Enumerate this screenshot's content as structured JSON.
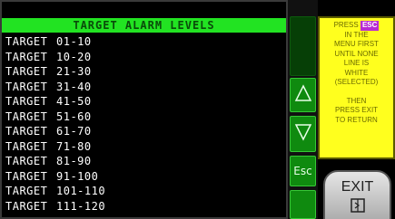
{
  "header": {
    "title": "TARGET ALARM LEVELS"
  },
  "list": {
    "items": [
      {
        "label": "TARGET",
        "range": "01-10"
      },
      {
        "label": "TARGET",
        "range": "10-20"
      },
      {
        "label": "TARGET",
        "range": "21-30"
      },
      {
        "label": "TARGET",
        "range": "31-40"
      },
      {
        "label": "TARGET",
        "range": "41-50"
      },
      {
        "label": "TARGET",
        "range": "51-60"
      },
      {
        "label": "TARGET",
        "range": "61-70"
      },
      {
        "label": "TARGET",
        "range": "71-80"
      },
      {
        "label": "TARGET",
        "range": "81-90"
      },
      {
        "label": "TARGET",
        "range": "91-100"
      },
      {
        "label": "TARGET",
        "range": "101-110"
      },
      {
        "label": "TARGET",
        "range": "111-120"
      }
    ]
  },
  "controls": {
    "esc_label": "Esc",
    "up_icon": "triangle-up",
    "down_icon": "triangle-down"
  },
  "info": {
    "press": "PRESS",
    "esc": "ESC",
    "lines": [
      "IN THE",
      "MENU FIRST",
      "UNTIL NONE",
      "LINE IS",
      "WHITE",
      "(SELECTED)"
    ],
    "lines2": [
      "THEN",
      "PRESS EXIT",
      "TO RETURN"
    ]
  },
  "exit": {
    "label": "EXIT",
    "icon": "exit-door-icon"
  },
  "colors": {
    "header_bg": "#22e322",
    "info_bg": "#ffff1e",
    "esc_badge": "#b82ad4",
    "button_green": "#0f8a0f"
  }
}
